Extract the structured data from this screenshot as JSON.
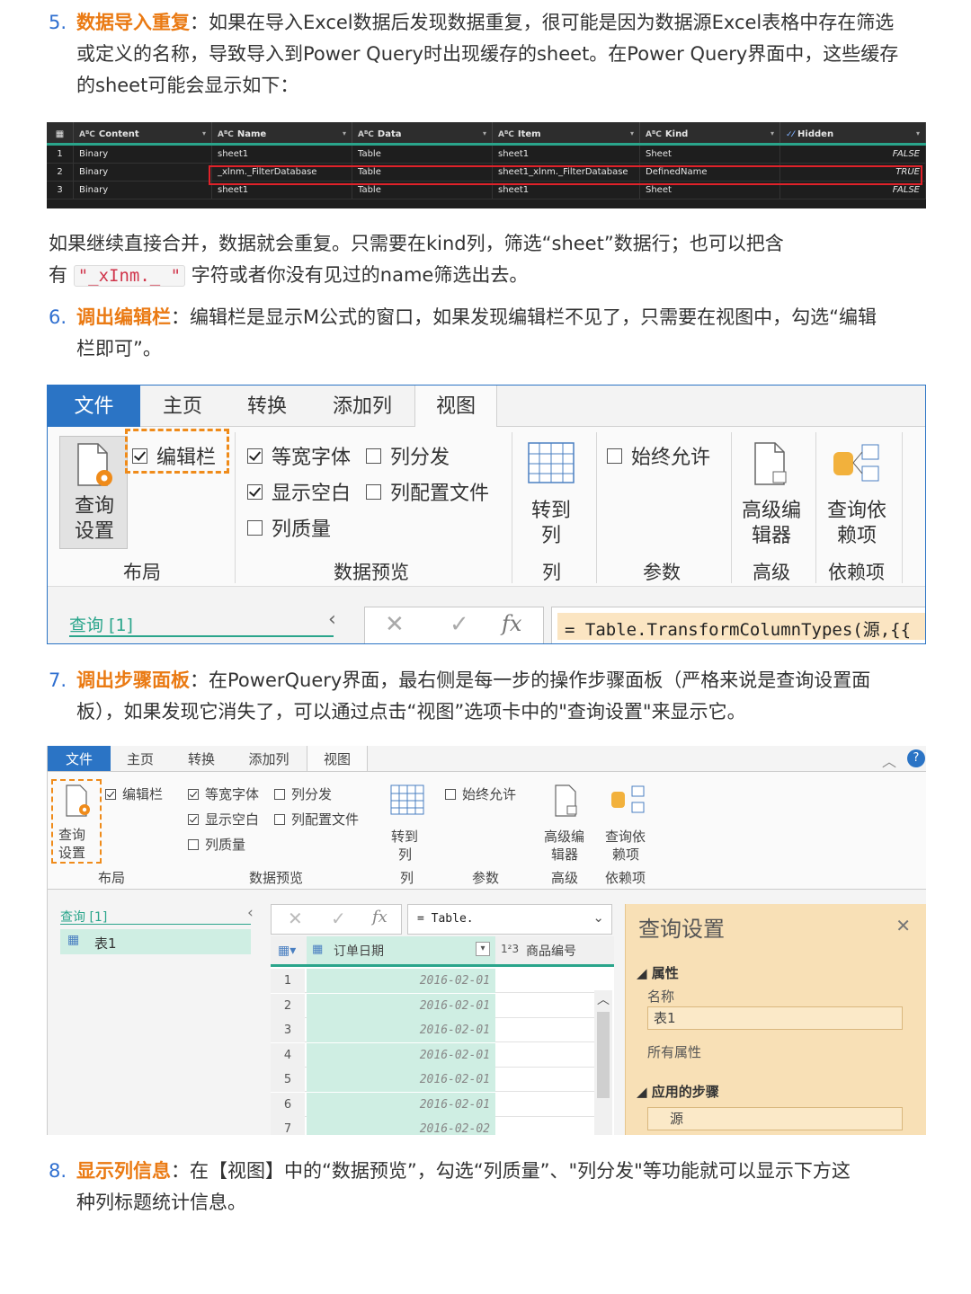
{
  "items": [
    {
      "num": "5.",
      "kw": "数据导入重复",
      "text1": "：如果在导入Excel数据后发现数据重复，很可能是因为数据源Excel表格中存在筛选",
      "text2": "或定义的名称，导致导入到Power Query时出现缓存的sheet。在Power Query界面中，这些缓存",
      "text3": "的sheet可能会显示如下："
    },
    {
      "num": "6.",
      "kw": "调出编辑栏",
      "text1": "：编辑栏是显示M公式的窗口，如果发现编辑栏不见了，只需要在视图中，勾选“编辑",
      "text2": "栏即可”。"
    },
    {
      "num": "7.",
      "kw": "调出步骤面板",
      "text1": "：在PowerQuery界面，最右侧是每一步的操作步骤面板（严格来说是查询设置面",
      "text2": "板），如果发现它消失了，可以通过点击“视图”选项卡中的\"查询设置\"来显示它。"
    },
    {
      "num": "8.",
      "kw": "显示列信息",
      "text1": "：在【视图】中的“数据预览”，勾选“列质量”、\"列分发\"等功能就可以显示下方这",
      "text2": "种列标题统计信息。"
    }
  ],
  "between": {
    "line1": "如果继续直接合并，数据就会重复。只需要在kind列，筛选“sheet”数据行；也可以把含",
    "pre": "有",
    "code": "\"_xInm._ \"",
    "post": "字符或者你没有见过的name筛选出去。"
  },
  "table1": {
    "headers": [
      "Content",
      "Name",
      "Data",
      "Item",
      "Kind",
      "Hidden"
    ],
    "type_glyph": "AᴮC",
    "rows": [
      [
        "1",
        "Binary",
        "sheet1",
        "Table",
        "sheet1",
        "Sheet",
        "FALSE"
      ],
      [
        "2",
        "Binary",
        "_xlnm._FilterDatabase",
        "Table",
        "sheet1_xlnm._FilterDatabase",
        "DefinedName",
        "TRUE"
      ],
      [
        "3",
        "Binary",
        "sheet1",
        "Table",
        "sheet1",
        "Sheet",
        "FALSE"
      ]
    ]
  },
  "ribbon": {
    "tabs": [
      "文件",
      "主页",
      "转换",
      "添加列",
      "视图"
    ],
    "query_settings_l1": "查询",
    "query_settings_l2": "设置",
    "formula_bar": "编辑栏",
    "monospace": "等宽字体",
    "col_dist": "列分发",
    "show_ws": "显示空白",
    "col_profile": "列配置文件",
    "col_quality": "列质量",
    "goto_l1": "转到",
    "goto_l2": "列",
    "always_allow": "始终允许",
    "adv_l1": "高级编",
    "adv_l2": "辑器",
    "dep_l1": "查询依",
    "dep_l2": "赖项",
    "groups": [
      "布局",
      "数据预览",
      "列",
      "参数",
      "高级",
      "依赖项"
    ],
    "queries": "查询 [1]",
    "formula_text": "= Table.TransformColumnTypes(源,{{",
    "fx": "fx"
  },
  "shot3": {
    "formula_text": "= Table.",
    "query_name": "表1",
    "col1": "订单日期",
    "col2": "商品编号",
    "col2_type": "1²3",
    "rows": [
      [
        "1",
        "2016-02-01"
      ],
      [
        "2",
        "2016-02-01"
      ],
      [
        "3",
        "2016-02-01"
      ],
      [
        "4",
        "2016-02-01"
      ],
      [
        "5",
        "2016-02-01"
      ],
      [
        "6",
        "2016-02-01"
      ],
      [
        "7",
        "2016-02-02"
      ]
    ],
    "panel_title": "查询设置",
    "props": "属性",
    "name_label": "名称",
    "name_value": "表1",
    "all_props": "所有属性",
    "applied_steps": "应用的步骤",
    "step1": "源"
  },
  "colors": {
    "blue": "#2b74c5",
    "orange": "#ea7a13",
    "green": "#2aa58b",
    "red": "#e0222a"
  }
}
